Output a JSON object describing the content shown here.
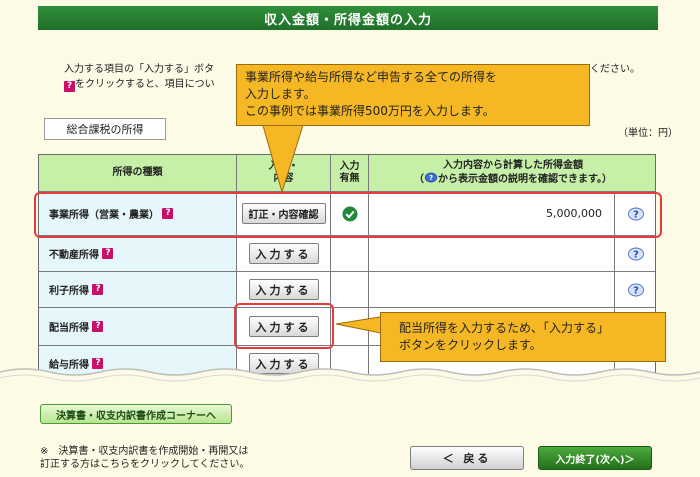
{
  "header": {
    "title": "収入金額・所得金額の入力"
  },
  "instructions": {
    "line1_start": "入力する項目の「入力する」ボタ",
    "line1_end": "ください。",
    "line2_text": "をクリックすると、項目につい"
  },
  "section_tab": "総合課税の所得",
  "unit_label": "（単位：円）",
  "table": {
    "headers": {
      "type": "所得の種類",
      "input_line1": "入力・",
      "input_line2": "内容",
      "flag_line1": "入力",
      "flag_line2": "有無",
      "amount_line1": "入力内容から計算した所得金額",
      "amount_line2_pre": "（",
      "amount_line2_post": "から表示金額の説明を確認できます。）"
    },
    "rows": [
      {
        "name": "事業所得（営業・農業）",
        "button": "訂正・内容確認",
        "entered": true,
        "amount": "5,000,000"
      },
      {
        "name": "不動産所得",
        "button": "入力する",
        "entered": false,
        "amount": ""
      },
      {
        "name": "利子所得",
        "button": "入力する",
        "entered": false,
        "amount": ""
      },
      {
        "name": "配当所得",
        "button": "入力する",
        "entered": false,
        "amount": ""
      },
      {
        "name": "給与所得",
        "button": "入力する",
        "entered": false,
        "amount": ""
      }
    ]
  },
  "callout_top": {
    "line1": "事業所得や給与所得など申告する全ての所得を",
    "line2": "入力します。",
    "line3": "この事例では事業所得500万円を入力します。"
  },
  "callout_bottom": {
    "line1": "配当所得を入力するため、「入力する」",
    "line2": "ボタンをクリックします。"
  },
  "kessan_button": "決算書・収支内訳書作成コーナーへ",
  "footnote": {
    "line1": "※　決算書・収支内訳書を作成開始・再開又は",
    "line2": "訂正する方はこちらをクリックしてください。"
  },
  "back_button": "＜ 戻る",
  "next_button": "入力終了(次へ)＞",
  "colors": {
    "header_green": "#1f6f29",
    "table_head": "#c6f0a8",
    "callout": "#f5b824",
    "highlight_red": "#e83c3c",
    "badge": "#c8106a"
  },
  "icons": [
    "question-badge-icon",
    "help-icon",
    "check-icon"
  ]
}
